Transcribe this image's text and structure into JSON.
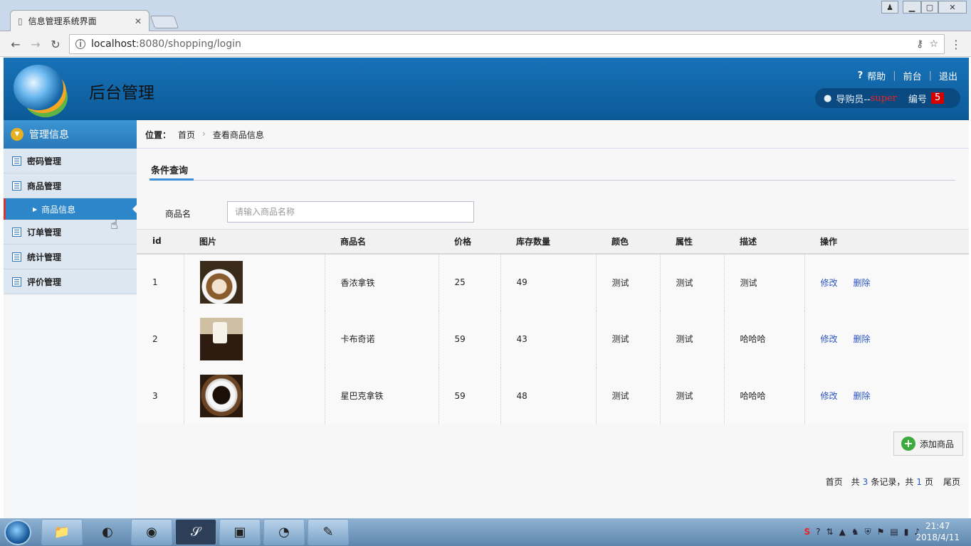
{
  "browser": {
    "tab_title": "信息管理系统界面",
    "url_host": "localhost",
    "url_rest": ":8080/shopping/login"
  },
  "header": {
    "app_title": "后台管理",
    "help": "帮助",
    "front": "前台",
    "logout": "退出",
    "user_label": "导购员--",
    "user_name": "super",
    "id_label": "编号",
    "id_value": "5"
  },
  "sidebar": {
    "title": "管理信息",
    "items": [
      {
        "label": "密码管理"
      },
      {
        "label": "商品管理"
      },
      {
        "label": "商品信息"
      },
      {
        "label": "订单管理"
      },
      {
        "label": "统计管理"
      },
      {
        "label": "评价管理"
      }
    ]
  },
  "breadcrumb": {
    "label": "位置：",
    "home": "首页",
    "current": "查看商品信息"
  },
  "filter": {
    "tab": "条件查询",
    "field_label": "商品名",
    "placeholder": "请输入商品名称"
  },
  "table": {
    "headers": [
      "id",
      "图片",
      "商品名",
      "价格",
      "库存数量",
      "颜色",
      "属性",
      "描述",
      "操作"
    ],
    "rows": [
      {
        "id": "1",
        "name": "香浓拿铁",
        "price": "25",
        "stock": "49",
        "color": "测试",
        "attr": "测试",
        "desc": "测试",
        "edit": "修改",
        "delete": "删除"
      },
      {
        "id": "2",
        "name": "卡布奇诺",
        "price": "59",
        "stock": "43",
        "color": "测试",
        "attr": "测试",
        "desc": "哈哈哈",
        "edit": "修改",
        "delete": "删除"
      },
      {
        "id": "3",
        "name": "星巴克拿铁",
        "price": "59",
        "stock": "48",
        "color": "测试",
        "attr": "测试",
        "desc": "哈哈哈",
        "edit": "修改",
        "delete": "删除"
      }
    ]
  },
  "add_button": "添加商品",
  "pager": {
    "first": "首页",
    "total_prefix": "共",
    "total": "3",
    "total_suffix": "条记录，共",
    "pages": "1",
    "pages_suffix": "页",
    "last": "尾页"
  },
  "taskbar": {
    "time": "21:47",
    "date": "2018/4/11"
  },
  "colors": {
    "header_blue": "#0b5a97",
    "link_blue": "#2a55c6",
    "badge_red": "#d40000"
  }
}
